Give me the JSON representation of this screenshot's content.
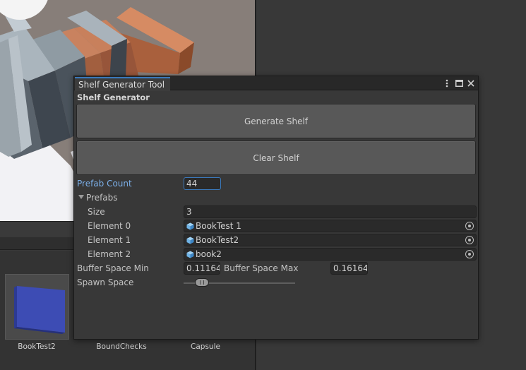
{
  "window": {
    "tab_title": "Shelf Generator Tool",
    "icons": [
      "kebab-menu-icon",
      "maximize-icon",
      "close-icon"
    ]
  },
  "tool": {
    "heading": "Shelf Generator",
    "generate_button": "Generate Shelf",
    "clear_button": "Clear Shelf",
    "prefab_count": {
      "label": "Prefab Count",
      "value": "44"
    },
    "prefabs": {
      "label": "Prefabs",
      "expanded": true,
      "size_label": "Size",
      "size_value": "3",
      "elements": [
        {
          "label": "Element 0",
          "value": "BookTest 1"
        },
        {
          "label": "Element 1",
          "value": "BookTest2"
        },
        {
          "label": "Element 2",
          "value": "book2"
        }
      ]
    },
    "buffer_min": {
      "label": "Buffer Space Min",
      "value": "0.11164:"
    },
    "buffer_max": {
      "label": "Buffer Space Max",
      "value": "0.16164:"
    },
    "spawn_space": {
      "label": "Spawn Space",
      "slider_fraction": 0.16
    }
  },
  "project": {
    "assets": [
      {
        "name": "BookTest2"
      },
      {
        "name": "BoundChecks"
      },
      {
        "name": "Capsule"
      }
    ]
  },
  "colors": {
    "accent": "#3a79bb",
    "label_highlight": "#7bafe8",
    "prefab_icon": "#6fb3e6"
  }
}
